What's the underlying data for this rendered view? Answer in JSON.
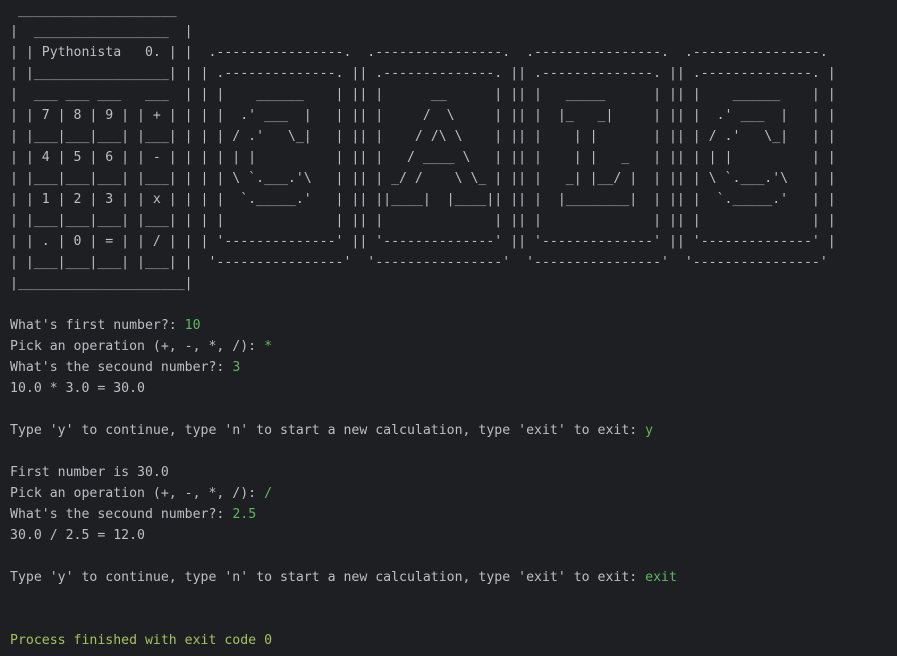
{
  "console": {
    "art_lines": [
      " ____________________",
      "|  _________________  |",
      "| | Pythonista   0. | |  .----------------.  .----------------.  .----------------.  .----------------.",
      "| |_________________| | | .--------------. || .--------------. || .--------------. || .--------------. |",
      "|  ___ ___ ___   ___  | | |    ______    | || |      __      | || |   _____      | || |    ______    | |",
      "| | 7 | 8 | 9 | | + | | | |  .' ___  |   | || |     /  \\     | || |  |_   _|     | || |  .' ___  |   | |",
      "| |___|___|___| |___| | | | / .'   \\_|   | || |    / /\\ \\    | || |    | |       | || | / .'   \\_|   | |",
      "| | 4 | 5 | 6 | | - | | | | | |          | || |   / ____ \\   | || |    | |   _   | || | | |          | |",
      "| |___|___|___| |___| | | | \\ `.___.'\\   | || | _/ /    \\ \\_ | || |   _| |__/ |  | || | \\ `.___.'\\   | |",
      "| | 1 | 2 | 3 | | x | | | |  `._____.'   | || ||____|  |____|| || |  |________|  | || |  `._____.'   | |",
      "| |___|___|___| |___| | | |              | || |              | || |              | || |              | |",
      "| | . | 0 | = | | / | | | '--------------' || '--------------' || '--------------' || '--------------' |",
      "| |___|___|___| |___| |  '----------------'  '----------------'  '----------------'  '----------------'",
      "|_____________________|"
    ],
    "session": [
      {
        "prompt": "",
        "value": ""
      },
      {
        "prompt": "What's first number?: ",
        "value": "10"
      },
      {
        "prompt": "Pick an operation (+, -, *, /): ",
        "value": "*"
      },
      {
        "prompt": "What's the secound number?: ",
        "value": "3"
      },
      {
        "prompt": "10.0 * 3.0 = 30.0",
        "value": ""
      },
      {
        "prompt": "",
        "value": ""
      },
      {
        "prompt": "Type 'y' to continue, type 'n' to start a new calculation, type 'exit' to exit: ",
        "value": "y"
      },
      {
        "prompt": "",
        "value": ""
      },
      {
        "prompt": "First number is 30.0",
        "value": ""
      },
      {
        "prompt": "Pick an operation (+, -, *, /): ",
        "value": "/"
      },
      {
        "prompt": "What's the secound number?: ",
        "value": "2.5"
      },
      {
        "prompt": "30.0 / 2.5 = 12.0",
        "value": ""
      },
      {
        "prompt": "",
        "value": ""
      },
      {
        "prompt": "Type 'y' to continue, type 'n' to start a new calculation, type 'exit' to exit: ",
        "value": "exit"
      },
      {
        "prompt": "",
        "value": ""
      },
      {
        "prompt": "",
        "value": ""
      },
      {
        "prompt": "Process finished with exit code 0",
        "value": ""
      }
    ]
  }
}
